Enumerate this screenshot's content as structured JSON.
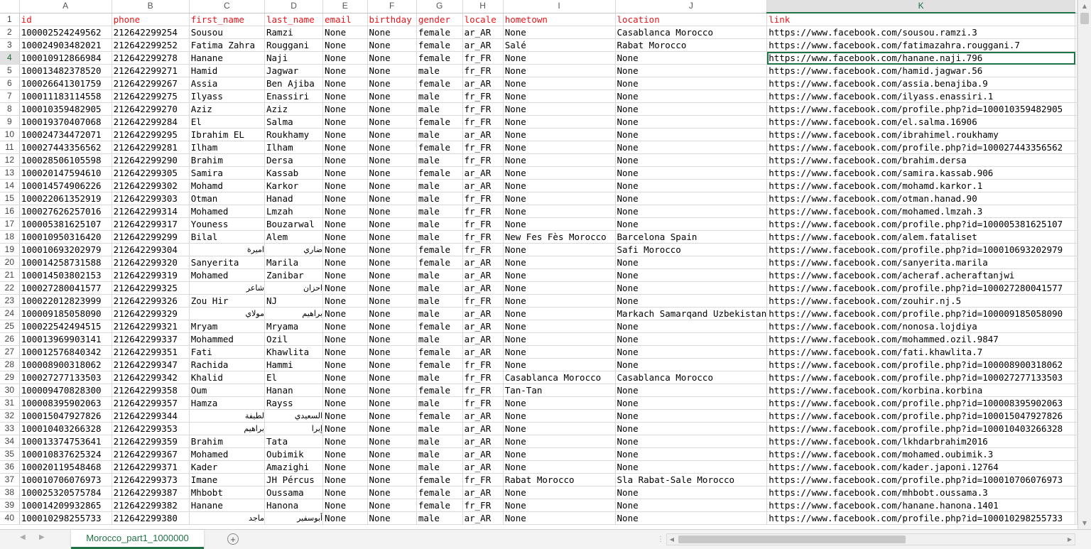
{
  "columns": [
    "A",
    "B",
    "C",
    "D",
    "E",
    "F",
    "G",
    "H",
    "I",
    "J",
    "K"
  ],
  "active_column": "K",
  "active_row": "4",
  "selected_cell": "K4",
  "rows": [
    {
      "n": "1",
      "cells": [
        "id",
        "phone",
        "first_name",
        "last_name",
        "email",
        "birthday",
        "gender",
        "locale",
        "hometown",
        "location",
        "link"
      ]
    },
    {
      "n": "2",
      "cells": [
        "100002524249562",
        "212642299254",
        "Sousou",
        "Ramzi",
        "None",
        "None",
        "female",
        "ar_AR",
        "None",
        "Casablanca Morocco",
        "https://www.facebook.com/sousou.ramzi.3"
      ]
    },
    {
      "n": "3",
      "cells": [
        "100024903482021",
        "212642299252",
        "Fatima Zahra",
        "Rouggani",
        "None",
        "None",
        "female",
        "ar_AR",
        "Salé",
        "Rabat Morocco",
        "https://www.facebook.com/fatimazahra.rouggani.7"
      ]
    },
    {
      "n": "4",
      "cells": [
        "100010912866984",
        "212642299278",
        "Hanane",
        "Naji",
        "None",
        "None",
        "female",
        "fr_FR",
        "None",
        "None",
        "https://www.facebook.com/hanane.naji.796"
      ]
    },
    {
      "n": "5",
      "cells": [
        "100013482378520",
        "212642299271",
        "Hamid",
        "Jagwar",
        "None",
        "None",
        "male",
        "fr_FR",
        "None",
        "None",
        "https://www.facebook.com/hamid.jagwar.56"
      ]
    },
    {
      "n": "6",
      "cells": [
        "100026641301759",
        "212642299267",
        "Assia",
        "Ben Ajiba",
        "None",
        "None",
        "female",
        "ar_AR",
        "None",
        "None",
        "https://www.facebook.com/assia.benajiba.9"
      ]
    },
    {
      "n": "7",
      "cells": [
        "100011183114558",
        "212642299275",
        "Ilyass",
        "Enassiri",
        "None",
        "None",
        "male",
        "fr_FR",
        "None",
        "None",
        "https://www.facebook.com/ilyass.enassiri.1"
      ]
    },
    {
      "n": "8",
      "cells": [
        "100010359482905",
        "212642299270",
        "Aziz",
        "Aziz",
        "None",
        "None",
        "male",
        "fr_FR",
        "None",
        "None",
        "https://www.facebook.com/profile.php?id=100010359482905"
      ]
    },
    {
      "n": "9",
      "cells": [
        "100019370407068",
        "212642299284",
        "El",
        "Salma",
        "None",
        "None",
        "female",
        "fr_FR",
        "None",
        "None",
        "https://www.facebook.com/el.salma.16906"
      ]
    },
    {
      "n": "10",
      "cells": [
        "100024734472071",
        "212642299295",
        "Ibrahim EL",
        "Roukhamy",
        "None",
        "None",
        "male",
        "ar_AR",
        "None",
        "None",
        "https://www.facebook.com/ibrahimel.roukhamy"
      ]
    },
    {
      "n": "11",
      "cells": [
        "100027443356562",
        "212642299281",
        "Ilham",
        "Ilham",
        "None",
        "None",
        "female",
        "fr_FR",
        "None",
        "None",
        "https://www.facebook.com/profile.php?id=100027443356562"
      ]
    },
    {
      "n": "12",
      "cells": [
        "100028506105598",
        "212642299290",
        "Brahim",
        "Dersa",
        "None",
        "None",
        "male",
        "fr_FR",
        "None",
        "None",
        "https://www.facebook.com/brahim.dersa"
      ]
    },
    {
      "n": "13",
      "cells": [
        "100020147594610",
        "212642299305",
        "Samira",
        "Kassab",
        "None",
        "None",
        "female",
        "ar_AR",
        "None",
        "None",
        "https://www.facebook.com/samira.kassab.906"
      ]
    },
    {
      "n": "14",
      "cells": [
        "100014574906226",
        "212642299302",
        "Mohamd",
        "Karkor",
        "None",
        "None",
        "male",
        "ar_AR",
        "None",
        "None",
        "https://www.facebook.com/mohamd.karkor.1"
      ]
    },
    {
      "n": "15",
      "cells": [
        "100022061352919",
        "212642299303",
        "Otman",
        "Hanad",
        "None",
        "None",
        "male",
        "fr_FR",
        "None",
        "None",
        "https://www.facebook.com/otman.hanad.90"
      ]
    },
    {
      "n": "16",
      "cells": [
        "100027626257016",
        "212642299314",
        "Mohamed",
        "Lmzah",
        "None",
        "None",
        "male",
        "fr_FR",
        "None",
        "None",
        "https://www.facebook.com/mohamed.lmzah.3"
      ]
    },
    {
      "n": "17",
      "cells": [
        "100005381625107",
        "212642299317",
        "Youness",
        "Bouzarwal",
        "None",
        "None",
        "male",
        "fr_FR",
        "None",
        "None",
        "https://www.facebook.com/profile.php?id=100005381625107"
      ]
    },
    {
      "n": "18",
      "cells": [
        "100010950316420",
        "212642299299",
        "Bilal",
        "Alem",
        "None",
        "None",
        "male",
        "fr_FR",
        "New Fes Fès Morocco",
        "Barcelona Spain",
        "https://www.facebook.com/alem.fataliset"
      ]
    },
    {
      "n": "19",
      "cells": [
        "100010693202979",
        "212642299304",
        "اميرة",
        "ضاري",
        "None",
        "None",
        "female",
        "fr_FR",
        "None",
        "Safi Morocco",
        "https://www.facebook.com/profile.php?id=100010693202979"
      ]
    },
    {
      "n": "20",
      "cells": [
        "100014258731588",
        "212642299320",
        "Sanyerita",
        "Marila",
        "None",
        "None",
        "female",
        "ar_AR",
        "None",
        "None",
        "https://www.facebook.com/sanyerita.marila"
      ]
    },
    {
      "n": "21",
      "cells": [
        "100014503802153",
        "212642299319",
        "Mohamed",
        "Zanibar",
        "None",
        "None",
        "male",
        "ar_AR",
        "None",
        "None",
        "https://www.facebook.com/acheraf.acheraftanjwi"
      ]
    },
    {
      "n": "22",
      "cells": [
        "100027280041577",
        "212642299325",
        "شاعر",
        "احزان",
        "None",
        "None",
        "male",
        "ar_AR",
        "None",
        "None",
        "https://www.facebook.com/profile.php?id=100027280041577"
      ]
    },
    {
      "n": "23",
      "cells": [
        "100022012823999",
        "212642299326",
        "Zou Hir",
        "NJ",
        "None",
        "None",
        "male",
        "fr_FR",
        "None",
        "None",
        "https://www.facebook.com/zouhir.nj.5"
      ]
    },
    {
      "n": "24",
      "cells": [
        "100009185058090",
        "212642299329",
        "مولاي",
        "براهيم",
        "None",
        "None",
        "male",
        "ar_AR",
        "None",
        "Markach Samarqand Uzbekistan",
        "https://www.facebook.com/profile.php?id=100009185058090"
      ]
    },
    {
      "n": "25",
      "cells": [
        "100022542494515",
        "212642299321",
        "Mryam",
        "Mryama",
        "None",
        "None",
        "female",
        "ar_AR",
        "None",
        "None",
        "https://www.facebook.com/nonosa.lojdiya"
      ]
    },
    {
      "n": "26",
      "cells": [
        "100013969903141",
        "212642299337",
        "Mohammed",
        "Ozil",
        "None",
        "None",
        "male",
        "ar_AR",
        "None",
        "None",
        "https://www.facebook.com/mohammed.ozil.9847"
      ]
    },
    {
      "n": "27",
      "cells": [
        "100012576840342",
        "212642299351",
        "Fati",
        "Khawlita",
        "None",
        "None",
        "female",
        "ar_AR",
        "None",
        "None",
        "https://www.facebook.com/fati.khawlita.7"
      ]
    },
    {
      "n": "28",
      "cells": [
        "100008900318062",
        "212642299347",
        "Rachida",
        "Hammi",
        "None",
        "None",
        "female",
        "fr_FR",
        "None",
        "None",
        "https://www.facebook.com/profile.php?id=100008900318062"
      ]
    },
    {
      "n": "29",
      "cells": [
        "100027277133503",
        "212642299342",
        "Khalid",
        "El",
        "None",
        "None",
        "male",
        "fr_FR",
        "Casablanca Morocco",
        "Casablanca Morocco",
        "https://www.facebook.com/profile.php?id=100027277133503"
      ]
    },
    {
      "n": "30",
      "cells": [
        "100009470828300",
        "212642299358",
        "Oum",
        "Hanan",
        "None",
        "None",
        "female",
        "fr_FR",
        "Tan-Tan",
        "None",
        "https://www.facebook.com/korbina.korbina"
      ]
    },
    {
      "n": "31",
      "cells": [
        "100008395902063",
        "212642299357",
        "Hamza",
        "Rayss",
        "None",
        "None",
        "male",
        "fr_FR",
        "None",
        "None",
        "https://www.facebook.com/profile.php?id=100008395902063"
      ]
    },
    {
      "n": "32",
      "cells": [
        "100015047927826",
        "212642299344",
        "لطيفة",
        "السعيدي",
        "None",
        "None",
        "female",
        "ar_AR",
        "None",
        "None",
        "https://www.facebook.com/profile.php?id=100015047927826"
      ]
    },
    {
      "n": "33",
      "cells": [
        "100010403266328",
        "212642299353",
        "براهيم",
        "إبرا",
        "None",
        "None",
        "male",
        "ar_AR",
        "None",
        "None",
        "https://www.facebook.com/profile.php?id=100010403266328"
      ]
    },
    {
      "n": "34",
      "cells": [
        "100013374753641",
        "212642299359",
        "Brahim",
        "Tata",
        "None",
        "None",
        "male",
        "ar_AR",
        "None",
        "None",
        "https://www.facebook.com/lkhdarbrahim2016"
      ]
    },
    {
      "n": "35",
      "cells": [
        "100010837625324",
        "212642299367",
        "Mohamed",
        "Oubimik",
        "None",
        "None",
        "male",
        "ar_AR",
        "None",
        "None",
        "https://www.facebook.com/mohamed.oubimik.3"
      ]
    },
    {
      "n": "36",
      "cells": [
        "100020119548468",
        "212642299371",
        "Kader",
        "Amazighi",
        "None",
        "None",
        "male",
        "ar_AR",
        "None",
        "None",
        "https://www.facebook.com/kader.japoni.12764"
      ]
    },
    {
      "n": "37",
      "cells": [
        "100010706076973",
        "212642299373",
        "Imane",
        "JH Pércus",
        "None",
        "None",
        "female",
        "fr_FR",
        "Rabat Morocco",
        "Sla Rabat-Sale Morocco",
        "https://www.facebook.com/profile.php?id=100010706076973"
      ]
    },
    {
      "n": "38",
      "cells": [
        "100025320575784",
        "212642299387",
        "Mhbobt",
        "Oussama",
        "None",
        "None",
        "female",
        "ar_AR",
        "None",
        "None",
        "https://www.facebook.com/mhbobt.oussama.3"
      ]
    },
    {
      "n": "39",
      "cells": [
        "100014209932865",
        "212642299382",
        "Hanane",
        "Hanona",
        "None",
        "None",
        "female",
        "fr_FR",
        "None",
        "None",
        "https://www.facebook.com/hanane.hanona.1401"
      ]
    },
    {
      "n": "40",
      "cells": [
        "100010298255733",
        "212642299380",
        "ماجد",
        "أبوسفير",
        "None",
        "None",
        "male",
        "ar_AR",
        "None",
        "None",
        "https://www.facebook.com/profile.php?id=100010298255733"
      ]
    }
  ],
  "sheet_tab": "Morocco_part1_1000000",
  "add_sheet_symbol": "+",
  "nav_prev": "◀",
  "nav_next": "▶",
  "split_symbol": "⋮",
  "scroll_up": "▲",
  "scroll_down": "▼",
  "scroll_left": "◀",
  "scroll_right": "▶",
  "colors": {
    "header_text": "#e8151b",
    "accent": "#217346"
  }
}
